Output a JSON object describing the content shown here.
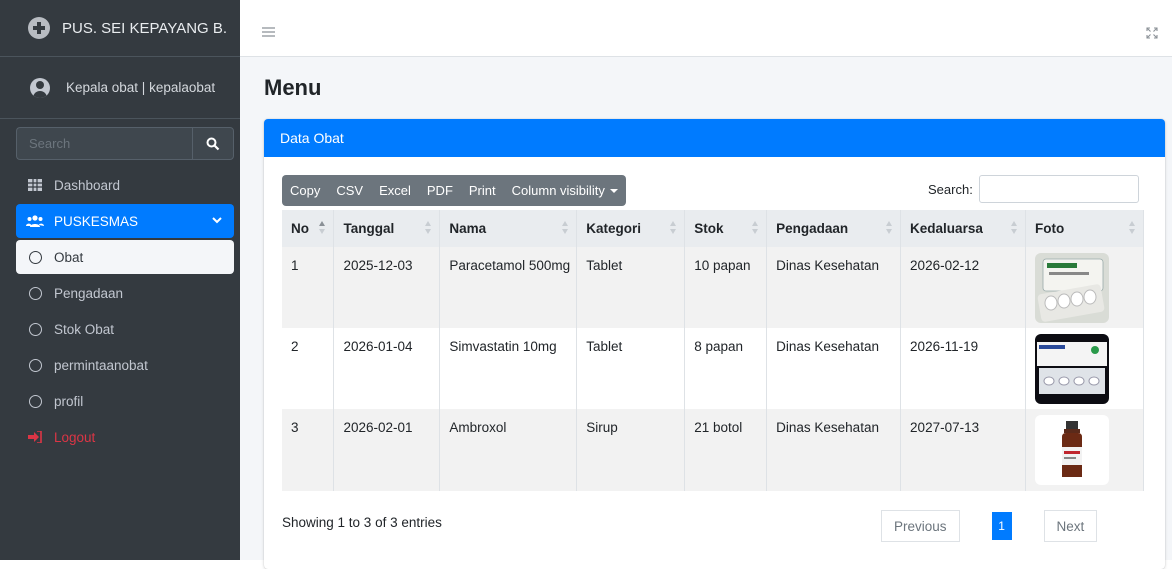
{
  "sidebar": {
    "brand": "PUS. SEI KEPAYANG B.",
    "user": "Kepala obat | kepalaobat",
    "search_placeholder": "Search",
    "menu": [
      {
        "label": "Dashboard",
        "icon": "table-icon"
      },
      {
        "label": "PUSKESMAS",
        "icon": "users-icon"
      },
      {
        "label": "Obat",
        "icon": "circle-icon"
      },
      {
        "label": "Pengadaan",
        "icon": "circle-icon"
      },
      {
        "label": "Stok Obat",
        "icon": "circle-icon"
      },
      {
        "label": "permintaanobat",
        "icon": "circle-icon"
      },
      {
        "label": "profil",
        "icon": "circle-icon"
      },
      {
        "label": "Logout",
        "icon": "sign-out-icon"
      }
    ]
  },
  "page": {
    "title": "Menu",
    "card_title": "Data Obat",
    "buttons": [
      "Copy",
      "CSV",
      "Excel",
      "PDF",
      "Print",
      "Column visibility"
    ],
    "search_label": "Search:",
    "columns": [
      "No",
      "Tanggal",
      "Nama",
      "Kategori",
      "Stok",
      "Pengadaan",
      "Kedaluarsa",
      "Foto"
    ],
    "rows": [
      {
        "no": "1",
        "tanggal": "2025-12-03",
        "nama": "Paracetamol 500mg",
        "kategori": "Tablet",
        "stok": "10 papan",
        "pengadaan": "Dinas Kesehatan",
        "kedaluarsa": "2026-02-12",
        "foto": "paracetamol-photo"
      },
      {
        "no": "2",
        "tanggal": "2026-01-04",
        "nama": "Simvastatin 10mg",
        "kategori": "Tablet",
        "stok": "8 papan",
        "pengadaan": "Dinas Kesehatan",
        "kedaluarsa": "2026-11-19",
        "foto": "simvastatin-photo"
      },
      {
        "no": "3",
        "tanggal": "2026-02-01",
        "nama": "Ambroxol",
        "kategori": "Sirup",
        "stok": "21 botol",
        "pengadaan": "Dinas Kesehatan",
        "kedaluarsa": "2027-07-13",
        "foto": "ambroxol-photo"
      }
    ],
    "info": "Showing 1 to 3 of 3 entries",
    "pager": {
      "previous": "Previous",
      "current": "1",
      "next": "Next"
    }
  },
  "colors": {
    "sidebar": "#343a40",
    "accent": "#007bff",
    "logout": "#dc3545",
    "content_bg": "#f4f6f9"
  }
}
